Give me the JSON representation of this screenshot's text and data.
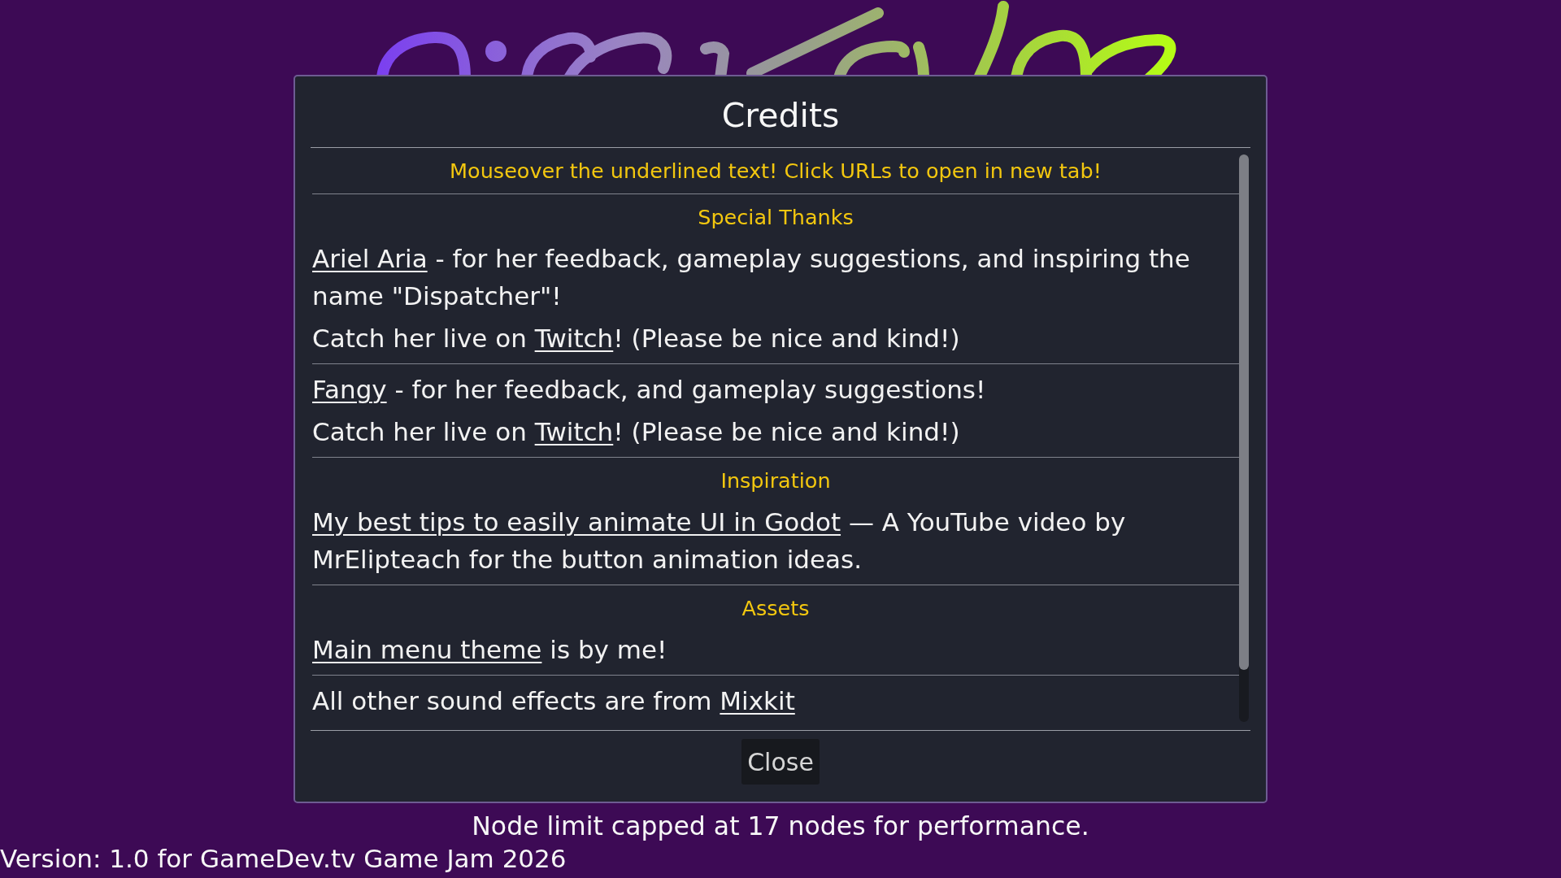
{
  "dialog": {
    "title": "Credits",
    "notice": "Mouseover the underlined text! Click URLs to open in new tab!",
    "sections": [
      {
        "heading": "Special Thanks",
        "entries": [
          {
            "paragraphs": [
              {
                "parts": [
                  {
                    "kind": "link",
                    "text": "Ariel Aria"
                  },
                  {
                    "kind": "plain",
                    "text": " - for her feedback, gameplay suggestions, and inspiring the name \"Dispatcher\"!"
                  }
                ]
              },
              {
                "parts": [
                  {
                    "kind": "plain",
                    "text": "Catch her live on "
                  },
                  {
                    "kind": "link",
                    "text": "Twitch"
                  },
                  {
                    "kind": "plain",
                    "text": "! (Please be nice and kind!)"
                  }
                ]
              }
            ]
          },
          {
            "paragraphs": [
              {
                "parts": [
                  {
                    "kind": "link",
                    "text": "Fangy"
                  },
                  {
                    "kind": "plain",
                    "text": " - for her feedback, and gameplay suggestions!"
                  }
                ]
              },
              {
                "parts": [
                  {
                    "kind": "plain",
                    "text": "Catch her live on "
                  },
                  {
                    "kind": "link",
                    "text": "Twitch"
                  },
                  {
                    "kind": "plain",
                    "text": "! (Please be nice and kind!)"
                  }
                ]
              }
            ]
          }
        ]
      },
      {
        "heading": "Inspiration",
        "entries": [
          {
            "paragraphs": [
              {
                "parts": [
                  {
                    "kind": "link",
                    "text": "My best tips to easily animate UI in Godot"
                  },
                  {
                    "kind": "plain",
                    "text": " — A YouTube video by MrElipteach for the button animation ideas."
                  }
                ]
              }
            ]
          }
        ]
      },
      {
        "heading": "Assets",
        "entries": [
          {
            "paragraphs": [
              {
                "parts": [
                  {
                    "kind": "link",
                    "text": "Main menu theme"
                  },
                  {
                    "kind": "plain",
                    "text": " is by me!"
                  }
                ]
              }
            ]
          },
          {
            "paragraphs": [
              {
                "parts": [
                  {
                    "kind": "plain",
                    "text": "All other sound effects are from "
                  },
                  {
                    "kind": "link",
                    "text": "Mixkit"
                  }
                ]
              }
            ]
          }
        ]
      }
    ],
    "close_button": "Close"
  },
  "node_limit_notice": "Node limit capped at 17 nodes for performance.",
  "version": "Version: 1.0 for GameDev.tv Game Jam 2026"
}
